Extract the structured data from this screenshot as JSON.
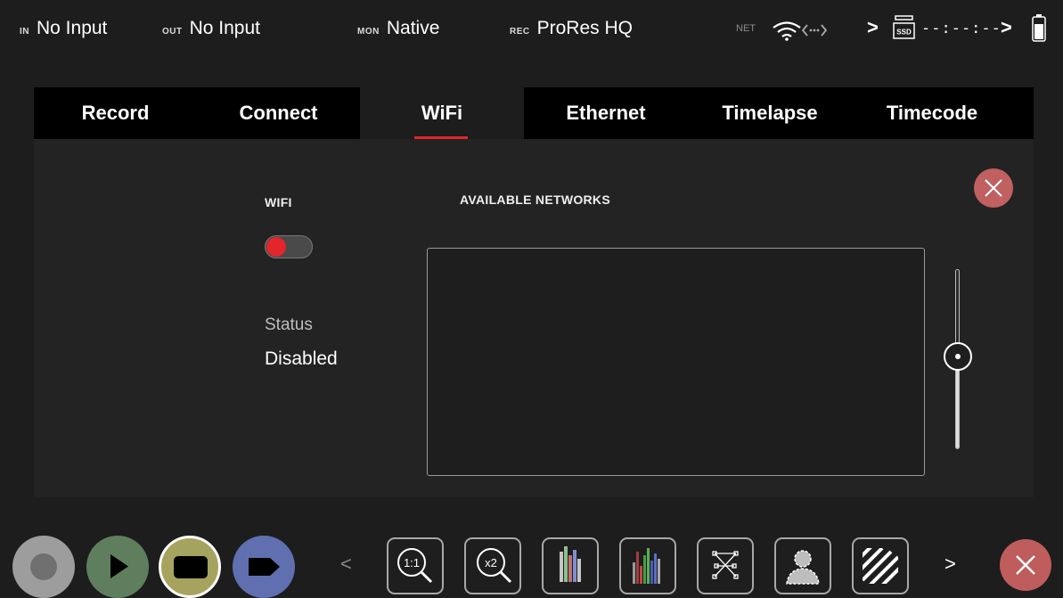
{
  "status_bar": {
    "in": {
      "tag": "IN",
      "value": "No Input"
    },
    "out": {
      "tag": "OUT",
      "value": "No Input"
    },
    "mon": {
      "tag": "MON",
      "value": "Native"
    },
    "rec": {
      "tag": "REC",
      "value": "ProRes HQ"
    },
    "net": {
      "tag": "NET",
      "icons": [
        "wifi-icon",
        "network-link-icon"
      ]
    },
    "storage": {
      "icon": "ssd-icon",
      "label": "SSD",
      "timecode": "--:--:--"
    },
    "battery_icon": "battery-icon",
    "chevrons": [
      ">",
      ">"
    ]
  },
  "tabs": [
    {
      "label": "Record",
      "active": false
    },
    {
      "label": "Connect",
      "active": false
    },
    {
      "label": "WiFi",
      "active": true
    },
    {
      "label": "Ethernet",
      "active": false
    },
    {
      "label": "Timelapse",
      "active": false
    },
    {
      "label": "Timecode",
      "active": false
    }
  ],
  "wifi_panel": {
    "wifi_label": "WIFI",
    "wifi_enabled": false,
    "status_label": "Status",
    "status_value": "Disabled",
    "networks_label": "AVAILABLE NETWORKS",
    "networks": [],
    "close_icon": "close-icon"
  },
  "bottom_bar": {
    "buttons": [
      {
        "name": "record-button",
        "icon": "record-icon"
      },
      {
        "name": "play-button",
        "icon": "play-icon"
      },
      {
        "name": "monitor-button",
        "icon": "monitor-icon"
      },
      {
        "name": "tag-button",
        "icon": "tag-icon"
      }
    ],
    "prev_chevron": "<",
    "next_chevron": ">",
    "tools": [
      {
        "name": "zoom-1-1",
        "label": "1:1",
        "icon": "magnifier-icon"
      },
      {
        "name": "zoom-x2",
        "label": "x2",
        "icon": "magnifier-icon"
      },
      {
        "name": "waveform",
        "icon": "waveform-icon"
      },
      {
        "name": "vectorscope",
        "icon": "histogram-icon"
      },
      {
        "name": "focus-peaking",
        "icon": "focus-icon"
      },
      {
        "name": "false-color",
        "icon": "person-icon"
      },
      {
        "name": "zebra",
        "icon": "zebra-icon"
      }
    ]
  },
  "colors": {
    "accent": "#e3262b",
    "close": "#c06060",
    "play": "#5e7e5e",
    "monitor": "#a6a35f",
    "tag": "#5f6fb0"
  }
}
